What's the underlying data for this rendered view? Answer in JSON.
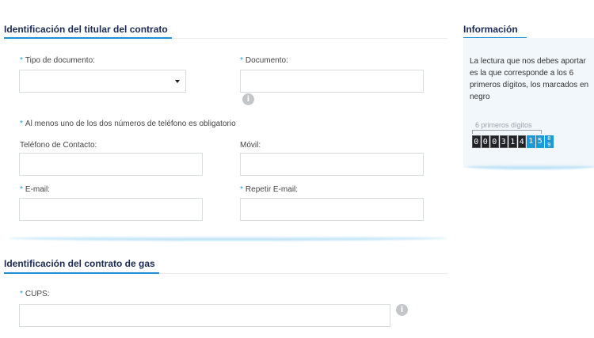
{
  "holder_section": {
    "title": "Identificación del titular del contrato",
    "doc_type_label": "Tipo de documento:",
    "doc_type_value": "",
    "document_label": "Documento:",
    "phone_note": "Al menos uno de los dos números de teléfono es obligatorio",
    "phone_label": "Teléfono de Contacto:",
    "mobile_label": "Móvil:",
    "email_label": "E-mail:",
    "repeat_email_label": "Repetir E-mail:",
    "required_mark": "*"
  },
  "gas_section": {
    "title": "Identificación del contrato de gas",
    "cups_label": "CUPS:"
  },
  "info_panel": {
    "title": "Información",
    "text": "La lectura que nos debes aportar es la que corresponde a los 6 primeros dígitos, los marcados en negro",
    "digits_caption": "6 primeros dígitos",
    "dark_digits": [
      "0",
      "0",
      "0",
      "3",
      "1",
      "4"
    ],
    "blue_digits": [
      "1",
      "5"
    ],
    "fraction_top": "8",
    "fraction_bottom": "9"
  },
  "icons": {
    "info": "i"
  },
  "colors": {
    "accent": "#1a9bd8",
    "title": "#1b2a55"
  }
}
